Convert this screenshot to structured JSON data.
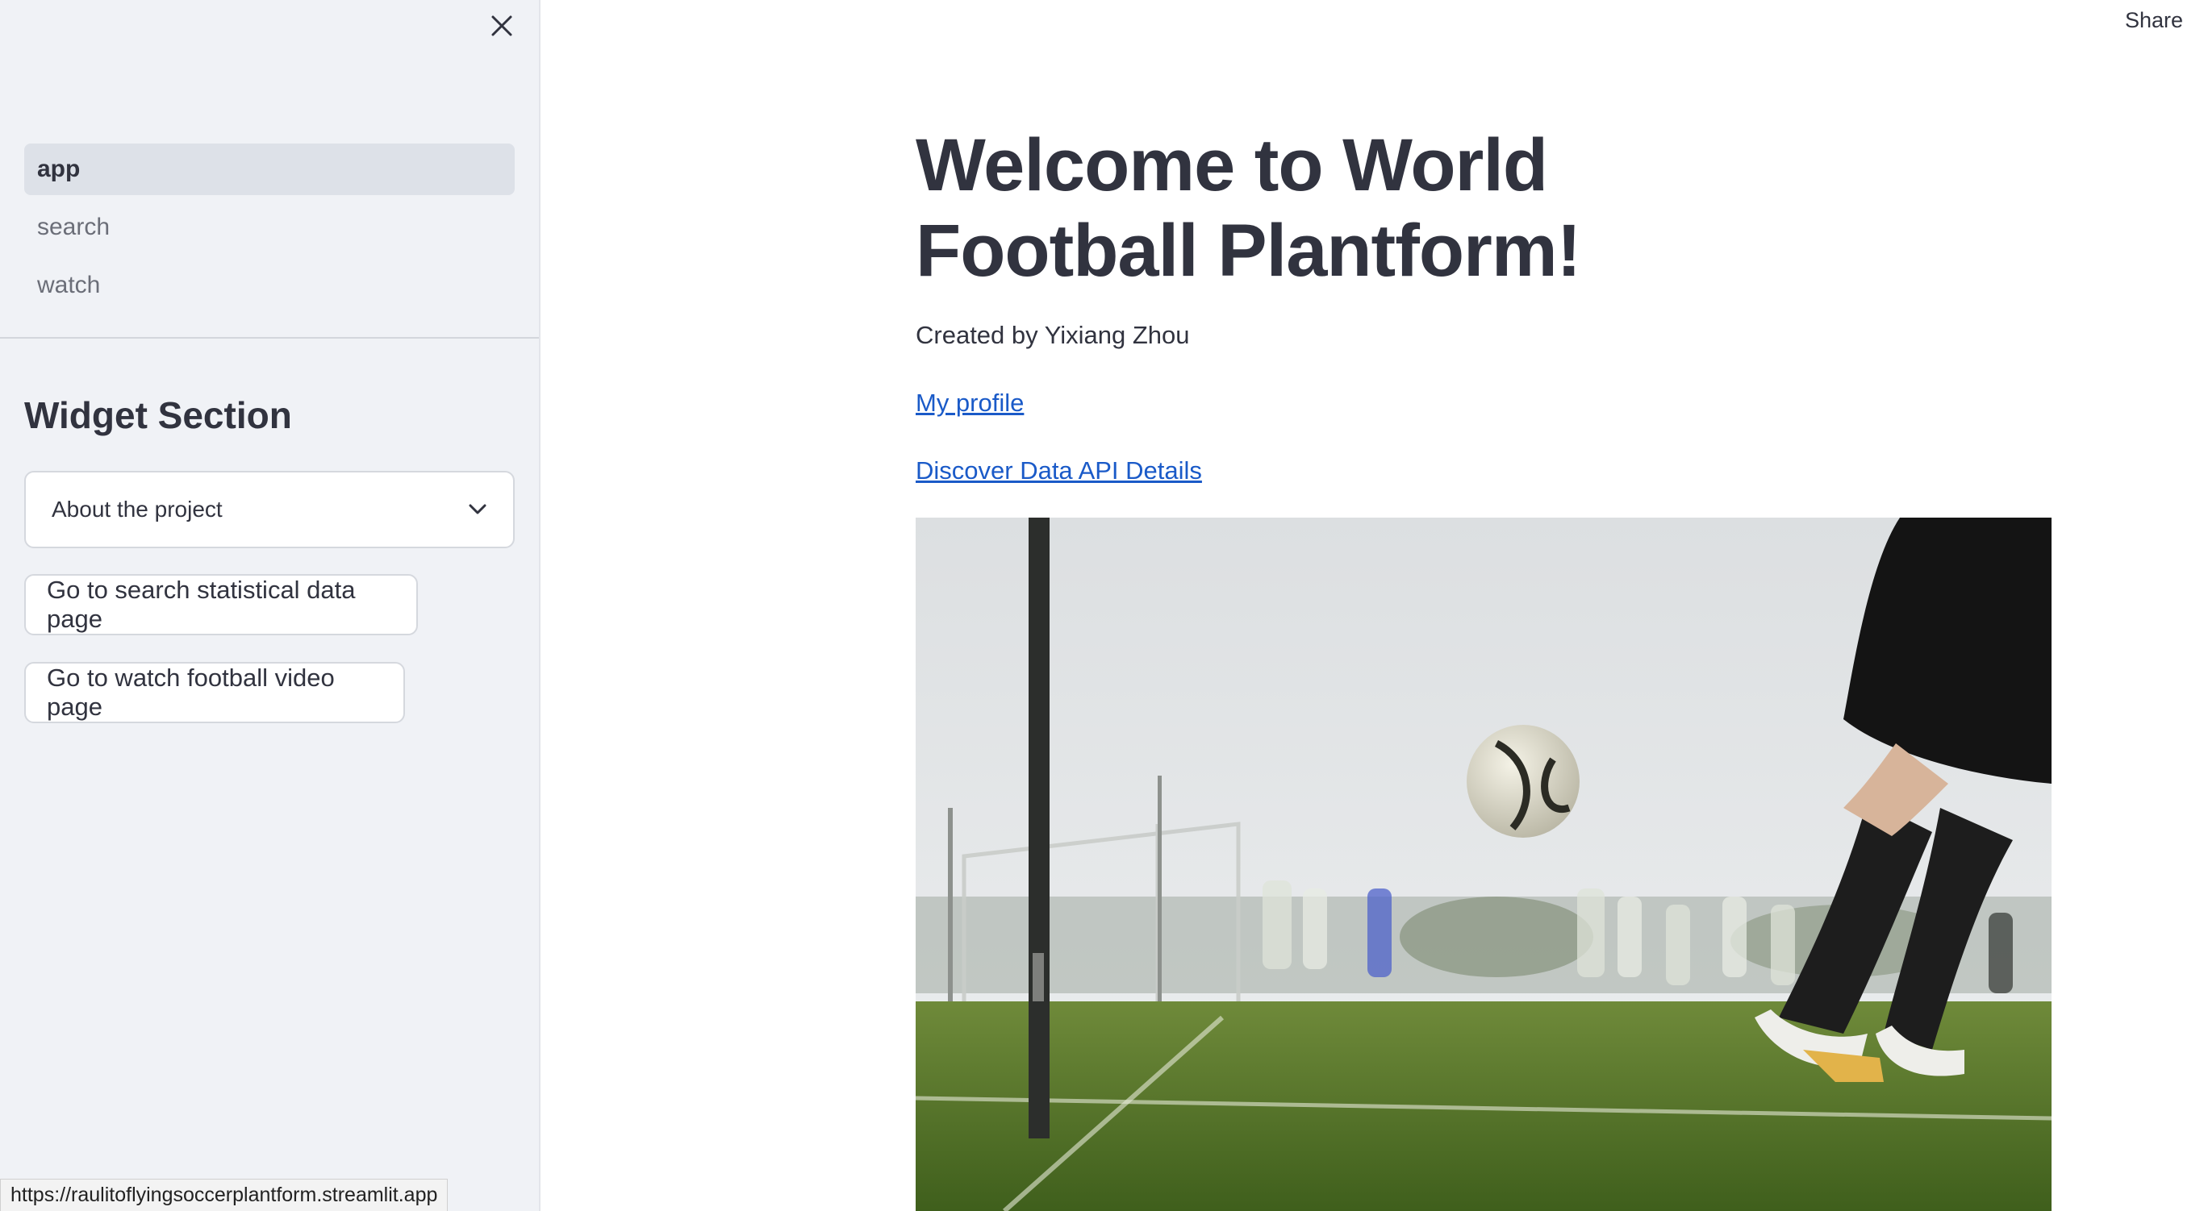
{
  "header": {
    "share_label": "Share"
  },
  "sidebar": {
    "nav_items": [
      {
        "label": "app",
        "active": true
      },
      {
        "label": "search",
        "active": false
      },
      {
        "label": "watch",
        "active": false
      }
    ],
    "widget_title": "Widget Section",
    "select": {
      "value": "About the project"
    },
    "buttons": [
      {
        "label": "Go to search statistical data page"
      },
      {
        "label": "Go to watch football video page"
      }
    ]
  },
  "main": {
    "title": "Welcome to World Football Plantform!",
    "created_by": "Created by Yixiang Zhou",
    "links": [
      {
        "label": "My profile"
      },
      {
        "label": "Discover Data API Details"
      }
    ]
  },
  "status_bar": {
    "url": "https://raulitoflyingsoccerplantform.streamlit.app"
  },
  "colors": {
    "sidebar_bg": "#f0f2f6",
    "active_nav_bg": "#dde1e8",
    "link": "#1a5ac8",
    "text": "#31333f"
  },
  "icons": {
    "close": "close-icon",
    "select_chevron": "chevron-down-icon"
  }
}
